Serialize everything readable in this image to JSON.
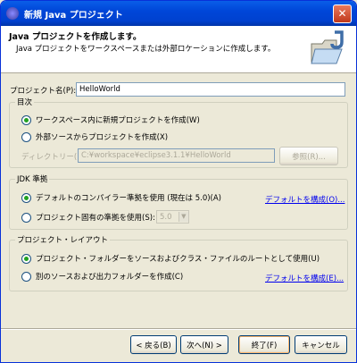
{
  "window": {
    "title": "新規 Java プロジェクト",
    "close_label": "✕"
  },
  "banner": {
    "heading": "Java プロジェクトを作成します。",
    "description": "Java プロジェクトをワークスペースまたは外部ロケーションに作成します。"
  },
  "project_name": {
    "label": "プロジェクト名(P):",
    "value": "HelloWorld"
  },
  "contents": {
    "legend": "目次",
    "option_new": "ワークスペース内に新規プロジェクトを作成(W)",
    "option_existing": "外部ソースからプロジェクトを作成(X)",
    "directory_label": "ディレクトリー(D):",
    "directory_value": "C:¥workspace¥eclipse3.1.1¥HelloWorld",
    "browse_label": "参照(R)..."
  },
  "jdk": {
    "legend": "JDK 準拠",
    "option_default": "デフォルトのコンパイラー準拠を使用 (現在は 5.0)(A)",
    "option_specific": "プロジェクト固有の準拠を使用(S):",
    "compliance_value": "5.0",
    "configure_link": "デフォルトを構成(O)..."
  },
  "layout": {
    "legend": "プロジェクト・レイアウト",
    "option_root": "プロジェクト・フォルダーをソースおよびクラス・ファイルのルートとして使用(U)",
    "option_separate": "別のソースおよび出力フォルダーを作成(C)",
    "configure_link": "デフォルトを構成(E)..."
  },
  "buttons": {
    "back": "< 戻る(B)",
    "next": "次へ(N) >",
    "finish": "終了(F)",
    "cancel": "キャンセル"
  }
}
